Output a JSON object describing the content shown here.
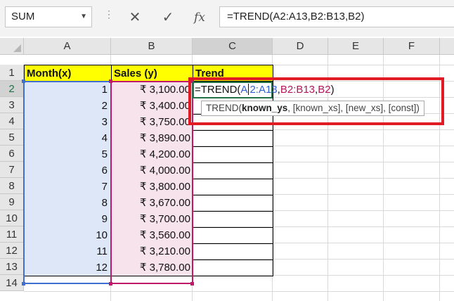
{
  "formula_bar": {
    "name_box": "SUM",
    "cancel_icon": "✕",
    "enter_icon": "✓",
    "fx_label": "fx",
    "formula": "=TREND(A2:A13,B2:B13,B2)"
  },
  "columns": [
    "A",
    "B",
    "C",
    "D",
    "E",
    "F"
  ],
  "rows": [
    "1",
    "2",
    "3",
    "4",
    "5",
    "6",
    "7",
    "8",
    "9",
    "10",
    "11",
    "12",
    "13",
    "14"
  ],
  "headers": {
    "a": "Month(x)",
    "b": "Sales (y)",
    "c": "Trend"
  },
  "data": [
    {
      "month": "1",
      "sales": "₹ 3,100.00"
    },
    {
      "month": "2",
      "sales": "₹ 3,400.00"
    },
    {
      "month": "3",
      "sales": "₹ 3,750.00"
    },
    {
      "month": "4",
      "sales": "₹ 3,890.00"
    },
    {
      "month": "5",
      "sales": "₹ 4,200.00"
    },
    {
      "month": "6",
      "sales": "₹ 4,000.00"
    },
    {
      "month": "7",
      "sales": "₹ 3,800.00"
    },
    {
      "month": "8",
      "sales": "₹ 3,670.00"
    },
    {
      "month": "9",
      "sales": "₹ 3,700.00"
    },
    {
      "month": "10",
      "sales": "₹ 3,560.00"
    },
    {
      "month": "11",
      "sales": "₹ 3,210.00"
    },
    {
      "month": "12",
      "sales": "₹ 3,780.00"
    }
  ],
  "edit": {
    "prefix": "=TREND(",
    "ref_a1": "A",
    "ref_a2": "2:A13",
    "comma1": ",",
    "ref_b": "B2:B13",
    "comma2": ",",
    "ref_b2": "B2",
    "suffix": ")"
  },
  "tooltip": {
    "fn": "TREND(",
    "arg1": "known_ys",
    "rest": ", [known_xs], [new_xs], [const])"
  },
  "colors": {
    "highlight_box": "#e01b24",
    "header_fill": "#ffff00",
    "ref_a": "#2f5fd0",
    "ref_b": "#b3145a"
  }
}
